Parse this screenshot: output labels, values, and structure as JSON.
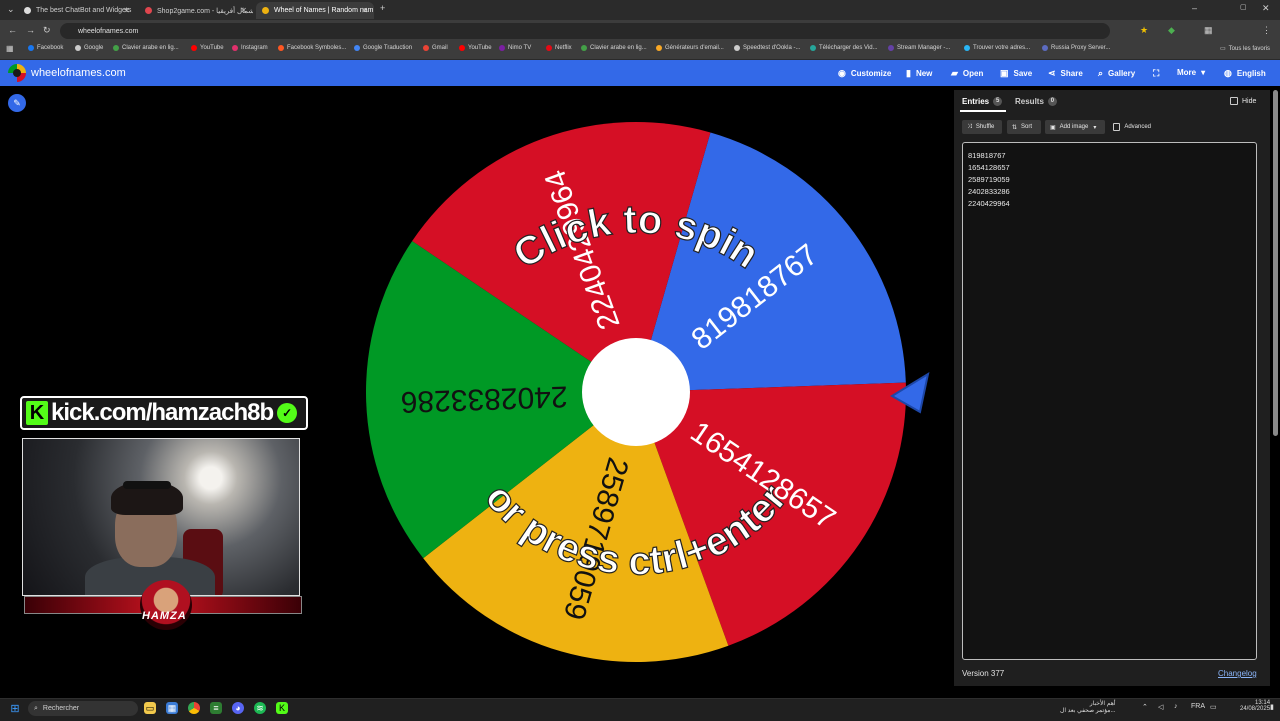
{
  "browser": {
    "tabs": [
      {
        "title": "The best ChatBot and Widgets",
        "active": false,
        "favicon_color": "#dddddd"
      },
      {
        "title": "Shop2game.com - شمال أفريقيا",
        "active": false,
        "favicon_color": "#e0464e"
      },
      {
        "title": "Wheel of Names | Random nam",
        "active": true,
        "favicon_color": "#eeb211"
      }
    ],
    "new_tab_label": "+",
    "url": "wheelofnames.com",
    "bookmarks": [
      {
        "label": "Facebook",
        "color": "#1877f2"
      },
      {
        "label": "Google",
        "color": "#cccccc"
      },
      {
        "label": "Clavier arabe en lig...",
        "color": "#43a047"
      },
      {
        "label": "YouTube",
        "color": "#ff0000"
      },
      {
        "label": "Instagram",
        "color": "#e1306c"
      },
      {
        "label": "Facebook Symboles...",
        "color": "#ff5722"
      },
      {
        "label": "Google Traduction",
        "color": "#4285f4"
      },
      {
        "label": "Gmail",
        "color": "#ea4335"
      },
      {
        "label": "YouTube",
        "color": "#ff0000"
      },
      {
        "label": "Nimo TV",
        "color": "#7b1fa2"
      },
      {
        "label": "Netflix",
        "color": "#e50914"
      },
      {
        "label": "Clavier arabe en lig...",
        "color": "#43a047"
      },
      {
        "label": "Générateurs d'email...",
        "color": "#f9a825"
      },
      {
        "label": "Speedtest d'Ookla -...",
        "color": "#cccccc"
      },
      {
        "label": "Télécharger des Vid...",
        "color": "#26a69a"
      },
      {
        "label": "Stream Manager -...",
        "color": "#6441a5"
      },
      {
        "label": "Trouver votre adres...",
        "color": "#29b6f6"
      },
      {
        "label": "Russia Proxy Server...",
        "color": "#5c6bc0"
      }
    ],
    "all_bookmarks_label": "Tous les favoris"
  },
  "app": {
    "site_name": "wheelofnames.com",
    "menu": [
      {
        "label": "Customize",
        "icon": "palette-icon",
        "glyph": "◉"
      },
      {
        "label": "New",
        "icon": "new-file-icon",
        "glyph": "▮"
      },
      {
        "label": "Open",
        "icon": "folder-icon",
        "glyph": "▰"
      },
      {
        "label": "Save",
        "icon": "save-icon",
        "glyph": "▣"
      },
      {
        "label": "Share",
        "icon": "share-icon",
        "glyph": "⋖"
      },
      {
        "label": "Gallery",
        "icon": "search-icon",
        "glyph": "⌕"
      },
      {
        "label": "",
        "icon": "fullscreen-icon",
        "glyph": "⛶"
      },
      {
        "label": "More",
        "icon": "chevron-down-icon",
        "glyph": "▾"
      },
      {
        "label": "English",
        "icon": "globe-icon",
        "glyph": "◍"
      }
    ]
  },
  "wheel": {
    "segments": [
      {
        "label": "819818767",
        "color": "#3369e8"
      },
      {
        "label": "1654128657",
        "color": "#d50f25"
      },
      {
        "label": "2589719059",
        "color": "#eeb211"
      },
      {
        "label": "2402833286",
        "color": "#009925"
      },
      {
        "label": "2240429964",
        "color": "#d50f25"
      }
    ],
    "overlay_top": "Click to spin",
    "overlay_bottom": "or press ctrl+enter",
    "pointer_color": "#3369e8"
  },
  "panel": {
    "entries_tab": "Entries",
    "entries_count": "5",
    "results_tab": "Results",
    "results_count": "0",
    "hide_label": "Hide",
    "shuffle_label": "Shuffle",
    "sort_label": "Sort",
    "add_image_label": "Add image",
    "advanced_label": "Advanced",
    "entries": [
      "819818767",
      "1654128657",
      "2589719059",
      "2402833286",
      "2240429964"
    ],
    "version": "Version 377",
    "changelog": "Changelog"
  },
  "overlay": {
    "kick_text": "kick.com/hamzach8b",
    "kick_logo": "K",
    "avatar_name": "HAMZA"
  },
  "taskbar": {
    "search_placeholder": "Rechercher",
    "news_line1": "أهم الأخبار",
    "news_line2": "مؤتمر صحفي بعد ال...",
    "lang": "FRA",
    "time": "13:14",
    "date": "24/08/2025"
  }
}
